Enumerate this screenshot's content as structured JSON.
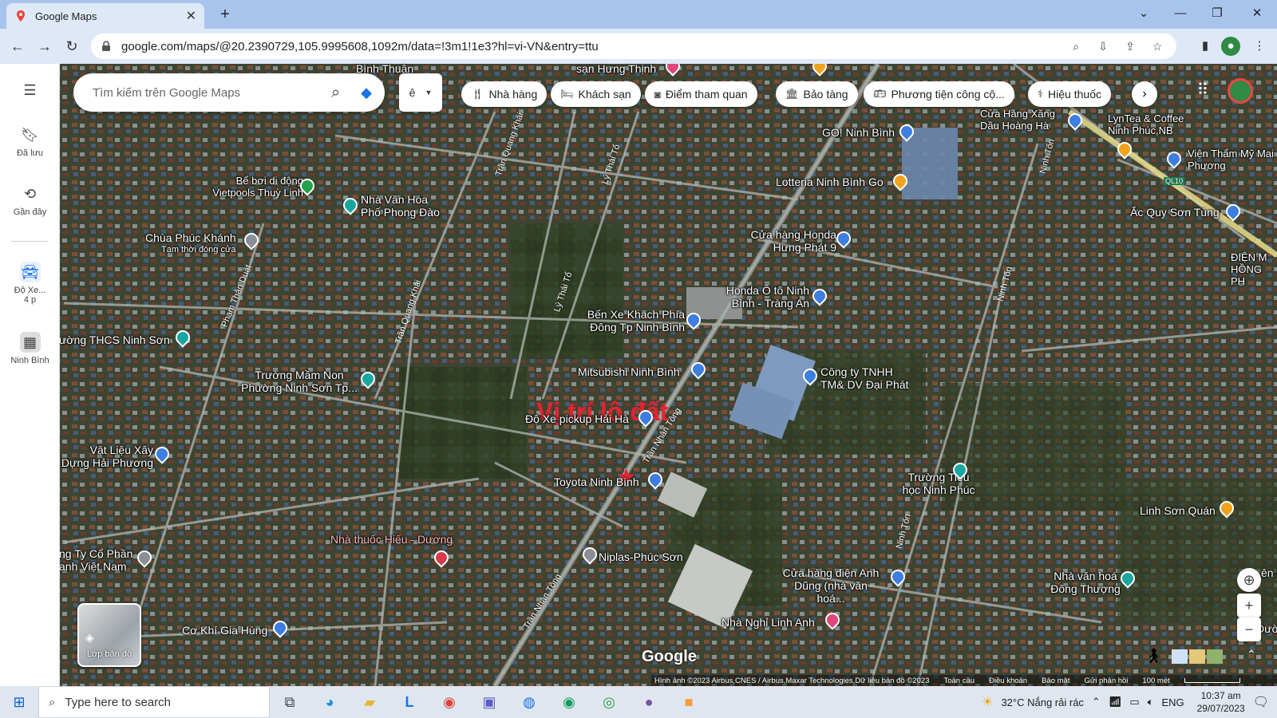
{
  "browser": {
    "tab_title": "Google Maps",
    "url": "google.com/maps/@20.2390729,105.9995608,1092m/data=!3m1!1e3?hl=vi-VN&entry=ttu"
  },
  "rail": {
    "saved": "Đã lưu",
    "recent": "Gần đây",
    "recent_place1_a": "Độ Xe...",
    "recent_place1_b": "4 p",
    "recent_place2": "Ninh Bình"
  },
  "search": {
    "placeholder": "Tìm kiếm trên Google Maps",
    "lang": "ê"
  },
  "chips": [
    "Nhà hàng",
    "Khách sạn",
    "Điểm tham quan",
    "Bảo tàng",
    "Phương tiện công cộ...",
    "Hiệu thuốc"
  ],
  "map": {
    "title_overlay": "Vị trí lô đất",
    "labels": {
      "go_ninhbinh": "GO! Ninh Bình",
      "lotteria": "Lotteria Ninh Bình Go",
      "cay_xang": "Cửa Hàng Xăng Dầu Hoàng Hà",
      "lyntea": "LynTea & Coffee Ninh Phúc,NB",
      "vien_tham_my": "Viện Thẩm Mỹ Mai Phương",
      "acquy": "Ắc Quy Sơn Tùng",
      "dien_hong": "ĐIỆN M HỒNG PH",
      "be_boi": "Bể bơi di động Vietpools Thuỳ Linh",
      "nha_van_hoa_pd": "Nhà Văn Hóa Phố Phong Đào",
      "chua": "Chùa Phúc Khánh",
      "chua_note": "Tạm thời đóng cửa",
      "cua_hang_honda": "Cửa hàng Honda Hưng Phát 9",
      "honda_oto": "Honda Ô tô Ninh Bình - Tràng An",
      "ben_xe": "Bến Xe Khách Phía Đông Tp Ninh Bình",
      "thcs": "ường THCS Ninh Sơn",
      "mitsubishi": "Mitsubishi Ninh Bình",
      "cong_ty_dai_phat": "Công ty TNHH TM& DV Đại Phát",
      "mam_non": "Trường Mầm Non Phường Ninh Sơn Tp...",
      "do_xe": "Độ Xe pickup Hải Hà",
      "vat_lieu": "Vật Liệu Xây Dựng Hải Phương",
      "toyota": "Toyota Ninh Bình",
      "tieu_hoc": "Trường Tiểu học Ninh Phúc",
      "linh_son_quan": "Linh Sơn Quán",
      "nha_thuoc": "Nhà thuốc Hiếu - Dương",
      "niplas": "Niplas-Phúc Sơn",
      "cong_ty_phan": "ng Ty Cổ Phần anh Việt Nam",
      "cua_hang_dien": "Cửa hàng điện Anh Dũng (nhà văn hoá...",
      "nha_van_hoa_dt": "Nhà văn hoá Đông Thượng",
      "co_khi": "Cơ Khí Gia Hùng",
      "nha_nghi": "Nhà Nghỉ Linh Anh",
      "binh_thuan": "Bình Thuận",
      "san_hung": "sạn Hưng Thịnh",
      "en_edge": "ên E",
      "duo_edge": "Đườ"
    },
    "roads": [
      "Trần Quang Khải",
      "Lý Thái Tổ",
      "Lý Thái Tổ",
      "Phạm Thận Duật",
      "Trần Quang Khải",
      "Trần Nhân Tông",
      "Trần Nhân Tông",
      "Ninh Tốn",
      "Ninh Tốn",
      "Ninh Tốn",
      "QL10"
    ],
    "layers_label": "Lớp bản đồ",
    "logo": "Google",
    "footer": [
      "Hình ảnh ©2023 Airbus,CNES / Airbus,Maxar Technologies,Dữ liệu bản đồ ©2023",
      "Toàn cầu",
      "Điều khoản",
      "Bảo mật",
      "Gửi phản hồi",
      "100 mét"
    ]
  },
  "taskbar": {
    "search": "Type here to search",
    "weather": "32°C  Nắng rải rác",
    "lang": "ENG",
    "time": "10:37 am",
    "date": "29/07/2023"
  },
  "colors": {
    "accent": "#1a73e8",
    "title_red": "#e8212f"
  }
}
